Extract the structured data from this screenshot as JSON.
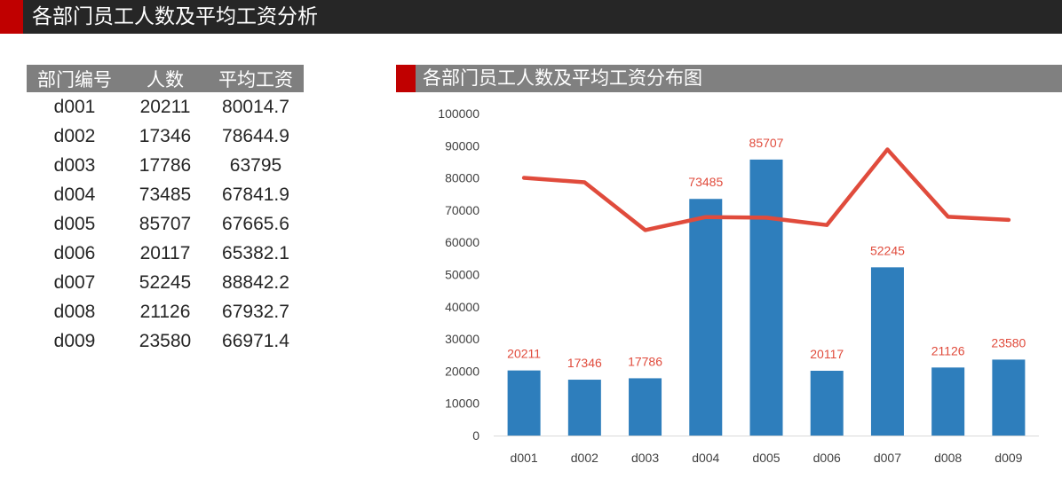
{
  "page": {
    "title": "各部门员工人数及平均工资分析"
  },
  "table": {
    "headers": [
      "部门编号",
      "人数",
      "平均工资"
    ],
    "rows": [
      [
        "d001",
        "20211",
        "80014.7"
      ],
      [
        "d002",
        "17346",
        "78644.9"
      ],
      [
        "d003",
        "17786",
        "63795"
      ],
      [
        "d004",
        "73485",
        "67841.9"
      ],
      [
        "d005",
        "85707",
        "67665.6"
      ],
      [
        "d006",
        "20117",
        "65382.1"
      ],
      [
        "d007",
        "52245",
        "88842.2"
      ],
      [
        "d008",
        "21126",
        "67932.7"
      ],
      [
        "d009",
        "23580",
        "66971.4"
      ]
    ]
  },
  "chart_header": {
    "title": "各部门员工人数及平均工资分布图"
  },
  "colors": {
    "bar": "#2e7ebc",
    "line": "#e04b3c",
    "label": "#e04b3c",
    "accent": "#c00000"
  },
  "chart_data": {
    "type": "bar",
    "title": "各部门员工人数及平均工资分布图",
    "categories": [
      "d001",
      "d002",
      "d003",
      "d004",
      "d005",
      "d006",
      "d007",
      "d008",
      "d009"
    ],
    "series": [
      {
        "type": "bar",
        "values": [
          20211,
          17346,
          17786,
          73485,
          85707,
          20117,
          52245,
          21126,
          23580
        ],
        "data_labels": true
      },
      {
        "type": "line",
        "values": [
          80014.7,
          78644.9,
          63795,
          67841.9,
          67665.6,
          65382.1,
          88842.2,
          67932.7,
          66971.4
        ],
        "data_labels": false
      }
    ],
    "ylim": [
      0,
      100000
    ],
    "yticks": [
      "0",
      "10000",
      "20000",
      "30000",
      "40000",
      "50000",
      "60000",
      "70000",
      "80000",
      "90000",
      "100000"
    ],
    "grid": false,
    "legend": "none"
  }
}
